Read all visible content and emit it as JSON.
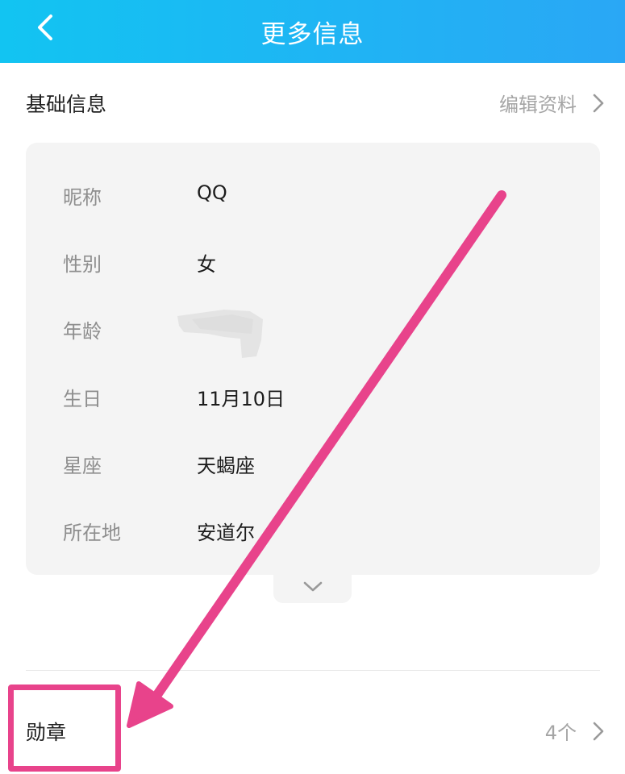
{
  "header": {
    "title": "更多信息",
    "back_icon": "chevron-left-icon"
  },
  "basic_info": {
    "title": "基础信息",
    "edit_label": "编辑资料",
    "rows": [
      {
        "label": "昵称",
        "value": "QQ"
      },
      {
        "label": "性别",
        "value": "女"
      },
      {
        "label": "年龄",
        "value": ""
      },
      {
        "label": "生日",
        "value": "11月10日"
      },
      {
        "label": "星座",
        "value": "天蝎座"
      },
      {
        "label": "所在地",
        "value": "安道尔"
      }
    ],
    "expand_icon": "chevron-down-icon"
  },
  "medals": {
    "label": "勋章",
    "count": "4个"
  },
  "colors": {
    "header_start": "#12c4f2",
    "header_end": "#2aa7f5",
    "annotation": "#e8438b",
    "card_bg": "#f4f4f4"
  }
}
